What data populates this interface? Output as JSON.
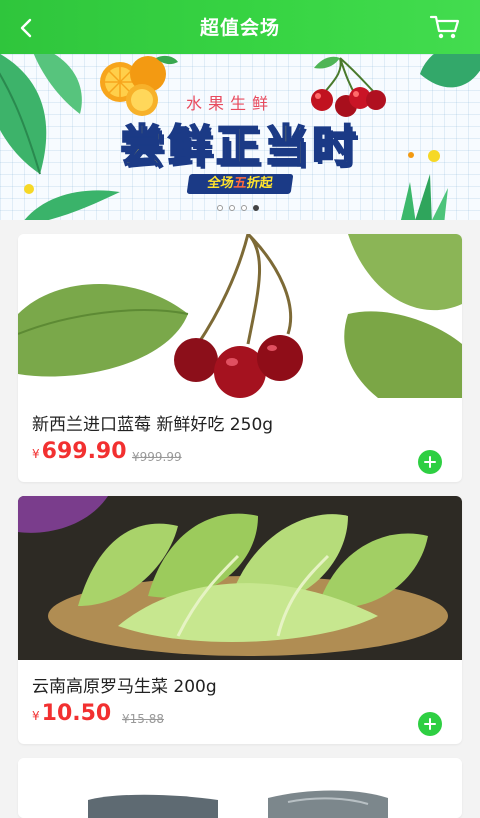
{
  "header": {
    "title": "超值会场",
    "back_icon": "chevron-left-icon",
    "cart_icon": "shopping-cart-icon"
  },
  "banner": {
    "subtitle": "水果生鲜",
    "title": "尝鲜正当时",
    "promo_prefix": "全场",
    "promo_highlight": "五",
    "promo_suffix": "折起",
    "dot_count": 4,
    "active_dot": 4
  },
  "products": [
    {
      "name": "新西兰进口蓝莓 新鲜好吃 250g",
      "currency": "¥",
      "price": "699.90",
      "original_price": "¥999.99",
      "image": "cherries-with-leaves"
    },
    {
      "name": "云南高原罗马生菜 200g",
      "currency": "¥",
      "price": "10.50",
      "original_price": "¥15.88",
      "image": "romaine-lettuce"
    },
    {
      "image": "oysters"
    }
  ],
  "colors": {
    "brand_green": "#37d443",
    "price_red": "#f23030",
    "add_button": "#2ecf42"
  }
}
